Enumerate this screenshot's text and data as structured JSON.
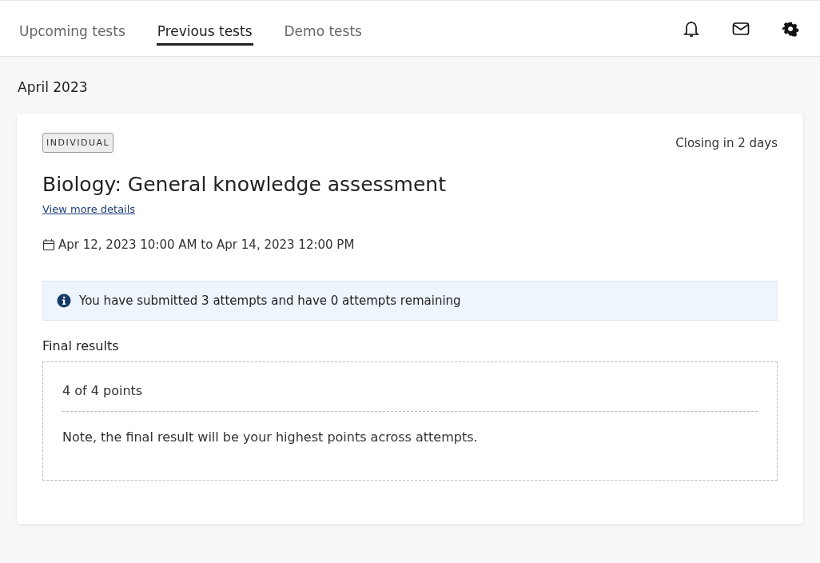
{
  "tabs": [
    {
      "label": "Upcoming tests",
      "selected": false
    },
    {
      "label": "Previous tests",
      "selected": true
    },
    {
      "label": "Demo tests",
      "selected": false
    }
  ],
  "month": "April 2023",
  "test": {
    "badge": "INDIVIDUAL",
    "closing": "Closing in 2 days",
    "title": "Biology: General knowledge assessment",
    "details_link": "View more details",
    "schedule": "Apr 12, 2023 10:00 AM to Apr 14, 2023 12:00 PM",
    "notice": "You have submitted 3 attempts and have 0 attempts remaining",
    "results_heading": "Final results",
    "score": "4 of 4 points",
    "note": "Note, the final result will be your highest points across attempts."
  }
}
